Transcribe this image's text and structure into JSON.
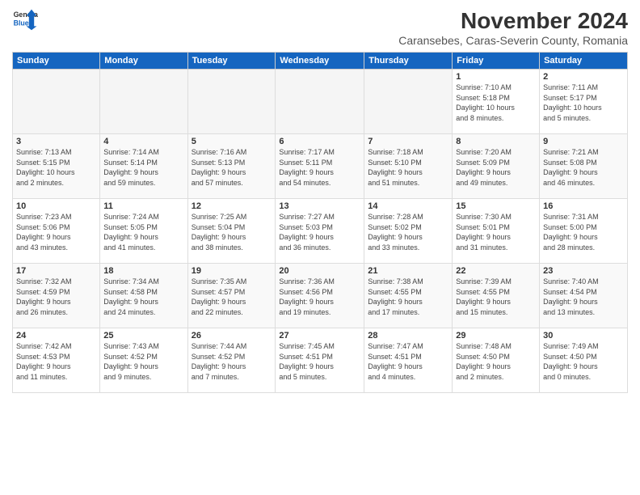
{
  "logo": {
    "line1": "General",
    "line2": "Blue"
  },
  "title": "November 2024",
  "subtitle": "Caransebes, Caras-Severin County, Romania",
  "headers": [
    "Sunday",
    "Monday",
    "Tuesday",
    "Wednesday",
    "Thursday",
    "Friday",
    "Saturday"
  ],
  "weeks": [
    [
      {
        "day": "",
        "info": ""
      },
      {
        "day": "",
        "info": ""
      },
      {
        "day": "",
        "info": ""
      },
      {
        "day": "",
        "info": ""
      },
      {
        "day": "",
        "info": ""
      },
      {
        "day": "1",
        "info": "Sunrise: 7:10 AM\nSunset: 5:18 PM\nDaylight: 10 hours\nand 8 minutes."
      },
      {
        "day": "2",
        "info": "Sunrise: 7:11 AM\nSunset: 5:17 PM\nDaylight: 10 hours\nand 5 minutes."
      }
    ],
    [
      {
        "day": "3",
        "info": "Sunrise: 7:13 AM\nSunset: 5:15 PM\nDaylight: 10 hours\nand 2 minutes."
      },
      {
        "day": "4",
        "info": "Sunrise: 7:14 AM\nSunset: 5:14 PM\nDaylight: 9 hours\nand 59 minutes."
      },
      {
        "day": "5",
        "info": "Sunrise: 7:16 AM\nSunset: 5:13 PM\nDaylight: 9 hours\nand 57 minutes."
      },
      {
        "day": "6",
        "info": "Sunrise: 7:17 AM\nSunset: 5:11 PM\nDaylight: 9 hours\nand 54 minutes."
      },
      {
        "day": "7",
        "info": "Sunrise: 7:18 AM\nSunset: 5:10 PM\nDaylight: 9 hours\nand 51 minutes."
      },
      {
        "day": "8",
        "info": "Sunrise: 7:20 AM\nSunset: 5:09 PM\nDaylight: 9 hours\nand 49 minutes."
      },
      {
        "day": "9",
        "info": "Sunrise: 7:21 AM\nSunset: 5:08 PM\nDaylight: 9 hours\nand 46 minutes."
      }
    ],
    [
      {
        "day": "10",
        "info": "Sunrise: 7:23 AM\nSunset: 5:06 PM\nDaylight: 9 hours\nand 43 minutes."
      },
      {
        "day": "11",
        "info": "Sunrise: 7:24 AM\nSunset: 5:05 PM\nDaylight: 9 hours\nand 41 minutes."
      },
      {
        "day": "12",
        "info": "Sunrise: 7:25 AM\nSunset: 5:04 PM\nDaylight: 9 hours\nand 38 minutes."
      },
      {
        "day": "13",
        "info": "Sunrise: 7:27 AM\nSunset: 5:03 PM\nDaylight: 9 hours\nand 36 minutes."
      },
      {
        "day": "14",
        "info": "Sunrise: 7:28 AM\nSunset: 5:02 PM\nDaylight: 9 hours\nand 33 minutes."
      },
      {
        "day": "15",
        "info": "Sunrise: 7:30 AM\nSunset: 5:01 PM\nDaylight: 9 hours\nand 31 minutes."
      },
      {
        "day": "16",
        "info": "Sunrise: 7:31 AM\nSunset: 5:00 PM\nDaylight: 9 hours\nand 28 minutes."
      }
    ],
    [
      {
        "day": "17",
        "info": "Sunrise: 7:32 AM\nSunset: 4:59 PM\nDaylight: 9 hours\nand 26 minutes."
      },
      {
        "day": "18",
        "info": "Sunrise: 7:34 AM\nSunset: 4:58 PM\nDaylight: 9 hours\nand 24 minutes."
      },
      {
        "day": "19",
        "info": "Sunrise: 7:35 AM\nSunset: 4:57 PM\nDaylight: 9 hours\nand 22 minutes."
      },
      {
        "day": "20",
        "info": "Sunrise: 7:36 AM\nSunset: 4:56 PM\nDaylight: 9 hours\nand 19 minutes."
      },
      {
        "day": "21",
        "info": "Sunrise: 7:38 AM\nSunset: 4:55 PM\nDaylight: 9 hours\nand 17 minutes."
      },
      {
        "day": "22",
        "info": "Sunrise: 7:39 AM\nSunset: 4:55 PM\nDaylight: 9 hours\nand 15 minutes."
      },
      {
        "day": "23",
        "info": "Sunrise: 7:40 AM\nSunset: 4:54 PM\nDaylight: 9 hours\nand 13 minutes."
      }
    ],
    [
      {
        "day": "24",
        "info": "Sunrise: 7:42 AM\nSunset: 4:53 PM\nDaylight: 9 hours\nand 11 minutes."
      },
      {
        "day": "25",
        "info": "Sunrise: 7:43 AM\nSunset: 4:52 PM\nDaylight: 9 hours\nand 9 minutes."
      },
      {
        "day": "26",
        "info": "Sunrise: 7:44 AM\nSunset: 4:52 PM\nDaylight: 9 hours\nand 7 minutes."
      },
      {
        "day": "27",
        "info": "Sunrise: 7:45 AM\nSunset: 4:51 PM\nDaylight: 9 hours\nand 5 minutes."
      },
      {
        "day": "28",
        "info": "Sunrise: 7:47 AM\nSunset: 4:51 PM\nDaylight: 9 hours\nand 4 minutes."
      },
      {
        "day": "29",
        "info": "Sunrise: 7:48 AM\nSunset: 4:50 PM\nDaylight: 9 hours\nand 2 minutes."
      },
      {
        "day": "30",
        "info": "Sunrise: 7:49 AM\nSunset: 4:50 PM\nDaylight: 9 hours\nand 0 minutes."
      }
    ]
  ]
}
